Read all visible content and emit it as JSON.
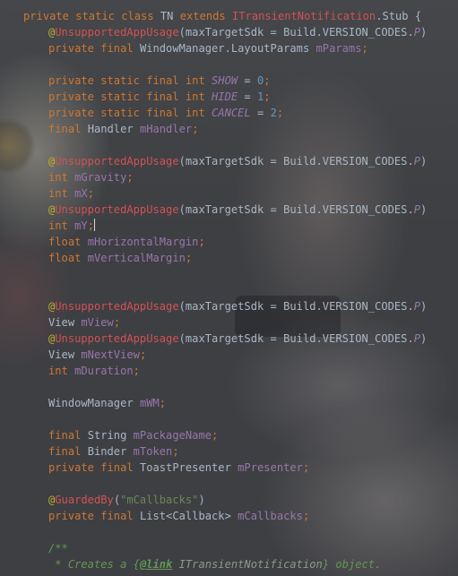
{
  "code": {
    "lines": [
      {
        "t": [
          [
            "kw",
            "private static class "
          ],
          [
            "p",
            "TN "
          ],
          [
            "kw",
            "extends "
          ],
          [
            "iface",
            "ITransientNotification"
          ],
          [
            "p",
            ".Stub {"
          ]
        ]
      },
      {
        "i": 1,
        "t": [
          [
            "ann",
            "@"
          ],
          [
            "ann-name",
            "UnsupportedAppUsage"
          ],
          [
            "p",
            "(maxTargetSdk = Build.VERSION_CODES."
          ],
          [
            "cst",
            "P"
          ],
          [
            "p",
            ")"
          ]
        ]
      },
      {
        "i": 1,
        "t": [
          [
            "kw",
            "private final "
          ],
          [
            "p",
            "WindowManager.LayoutParams "
          ],
          [
            "field",
            "mParams"
          ],
          [
            "kw",
            ";"
          ]
        ]
      },
      {
        "t": []
      },
      {
        "i": 1,
        "t": [
          [
            "kw",
            "private static final int "
          ],
          [
            "cst",
            "SHOW"
          ],
          [
            "p",
            " = "
          ],
          [
            "num",
            "0"
          ],
          [
            "kw",
            ";"
          ]
        ]
      },
      {
        "i": 1,
        "t": [
          [
            "kw",
            "private static final int "
          ],
          [
            "cst",
            "HIDE"
          ],
          [
            "p",
            " = "
          ],
          [
            "num",
            "1"
          ],
          [
            "kw",
            ";"
          ]
        ]
      },
      {
        "i": 1,
        "t": [
          [
            "kw",
            "private static final int "
          ],
          [
            "cst",
            "CANCEL"
          ],
          [
            "p",
            " = "
          ],
          [
            "num",
            "2"
          ],
          [
            "kw",
            ";"
          ]
        ]
      },
      {
        "i": 1,
        "t": [
          [
            "kw",
            "final "
          ],
          [
            "p",
            "Handler "
          ],
          [
            "field",
            "mHandler"
          ],
          [
            "kw",
            ";"
          ]
        ]
      },
      {
        "t": []
      },
      {
        "i": 1,
        "t": [
          [
            "ann",
            "@"
          ],
          [
            "ann-name",
            "UnsupportedAppUsage"
          ],
          [
            "p",
            "(maxTargetSdk = Build.VERSION_CODES."
          ],
          [
            "cst",
            "P"
          ],
          [
            "p",
            ")"
          ]
        ]
      },
      {
        "i": 1,
        "t": [
          [
            "kw",
            "int "
          ],
          [
            "field",
            "mGravity"
          ],
          [
            "kw",
            ";"
          ]
        ]
      },
      {
        "i": 1,
        "t": [
          [
            "kw",
            "int "
          ],
          [
            "field",
            "mX"
          ],
          [
            "kw",
            ";"
          ]
        ]
      },
      {
        "i": 1,
        "t": [
          [
            "ann",
            "@"
          ],
          [
            "ann-name",
            "UnsupportedAppUsage"
          ],
          [
            "p",
            "(maxTargetSdk = Build.VERSION_CODES."
          ],
          [
            "cst",
            "P"
          ],
          [
            "p",
            ")"
          ]
        ]
      },
      {
        "i": 1,
        "t": [
          [
            "kw",
            "int "
          ],
          [
            "field",
            "mY"
          ],
          [
            "kw",
            ";"
          ]
        ],
        "caret": true
      },
      {
        "i": 1,
        "t": [
          [
            "kw",
            "float "
          ],
          [
            "field",
            "mHorizontalMargin"
          ],
          [
            "kw",
            ";"
          ]
        ]
      },
      {
        "i": 1,
        "t": [
          [
            "kw",
            "float "
          ],
          [
            "field",
            "mVerticalMargin"
          ],
          [
            "kw",
            ";"
          ]
        ]
      },
      {
        "t": []
      },
      {
        "t": []
      },
      {
        "i": 1,
        "t": [
          [
            "ann",
            "@"
          ],
          [
            "ann-name",
            "UnsupportedAppUsage"
          ],
          [
            "p",
            "(maxTargetSdk = Build.VERSION_CODES."
          ],
          [
            "cst",
            "P"
          ],
          [
            "p",
            ")"
          ]
        ]
      },
      {
        "i": 1,
        "t": [
          [
            "p",
            "View "
          ],
          [
            "field",
            "mView"
          ],
          [
            "kw",
            ";"
          ]
        ]
      },
      {
        "i": 1,
        "t": [
          [
            "ann",
            "@"
          ],
          [
            "ann-name",
            "UnsupportedAppUsage"
          ],
          [
            "p",
            "(maxTargetSdk = Build.VERSION_CODES."
          ],
          [
            "cst",
            "P"
          ],
          [
            "p",
            ")"
          ]
        ]
      },
      {
        "i": 1,
        "t": [
          [
            "p",
            "View "
          ],
          [
            "field",
            "mNextView"
          ],
          [
            "kw",
            ";"
          ]
        ]
      },
      {
        "i": 1,
        "t": [
          [
            "kw",
            "int "
          ],
          [
            "field",
            "mDuration"
          ],
          [
            "kw",
            ";"
          ]
        ]
      },
      {
        "t": []
      },
      {
        "i": 1,
        "t": [
          [
            "p",
            "WindowManager "
          ],
          [
            "field",
            "mWM"
          ],
          [
            "kw",
            ";"
          ]
        ]
      },
      {
        "t": []
      },
      {
        "i": 1,
        "t": [
          [
            "kw",
            "final "
          ],
          [
            "p",
            "String "
          ],
          [
            "field",
            "mPackageName"
          ],
          [
            "kw",
            ";"
          ]
        ]
      },
      {
        "i": 1,
        "t": [
          [
            "kw",
            "final "
          ],
          [
            "p",
            "Binder "
          ],
          [
            "field",
            "mToken"
          ],
          [
            "kw",
            ";"
          ]
        ]
      },
      {
        "i": 1,
        "t": [
          [
            "kw",
            "private final "
          ],
          [
            "p",
            "ToastPresenter "
          ],
          [
            "field",
            "mPresenter"
          ],
          [
            "kw",
            ";"
          ]
        ]
      },
      {
        "t": []
      },
      {
        "i": 1,
        "t": [
          [
            "ann",
            "@"
          ],
          [
            "ann-name",
            "GuardedBy"
          ],
          [
            "p",
            "("
          ],
          [
            "str",
            "\"mCallbacks\""
          ],
          [
            "p",
            ")"
          ]
        ]
      },
      {
        "i": 1,
        "t": [
          [
            "kw",
            "private final "
          ],
          [
            "p",
            "List<Callback> "
          ],
          [
            "field",
            "mCallbacks"
          ],
          [
            "kw",
            ";"
          ]
        ]
      },
      {
        "t": []
      },
      {
        "i": 1,
        "t": [
          [
            "cmt",
            "/**"
          ]
        ]
      },
      {
        "i": 1,
        "t": [
          [
            "cmt",
            " * Creates a {"
          ],
          [
            "cmt-tag",
            "@link"
          ],
          [
            "cmt-ref",
            " ITransientNotification"
          ],
          [
            "cmt",
            "} object."
          ]
        ]
      }
    ]
  }
}
